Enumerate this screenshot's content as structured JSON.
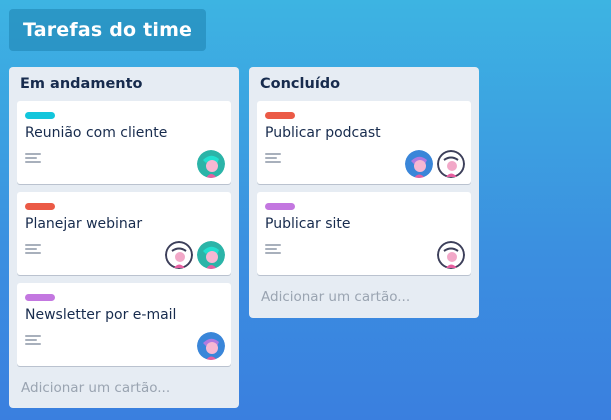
{
  "board": {
    "title": "Tarefas do time"
  },
  "colors": {
    "cyan": "#12c6dc",
    "red": "#eb5a46",
    "purple": "#c377e0"
  },
  "lists": [
    {
      "title": "Em andamento",
      "cards": [
        {
          "title": "Reunião com cliente",
          "label_color": "#12c6dc",
          "members": [
            "avatar-teal"
          ]
        },
        {
          "title": "Planejar webinar",
          "label_color": "#eb5a46",
          "members": [
            "avatar-white",
            "avatar-teal"
          ]
        },
        {
          "title": "Newsletter por e-mail",
          "label_color": "#c377e0",
          "members": [
            "avatar-blue"
          ]
        }
      ],
      "add_card_label": "Adicionar um cartão..."
    },
    {
      "title": "Concluído",
      "cards": [
        {
          "title": "Publicar podcast",
          "label_color": "#eb5a46",
          "members": [
            "avatar-blue",
            "avatar-white"
          ]
        },
        {
          "title": "Publicar site",
          "label_color": "#c377e0",
          "members": [
            "avatar-white"
          ]
        }
      ],
      "add_card_label": "Adicionar um cartão..."
    }
  ]
}
